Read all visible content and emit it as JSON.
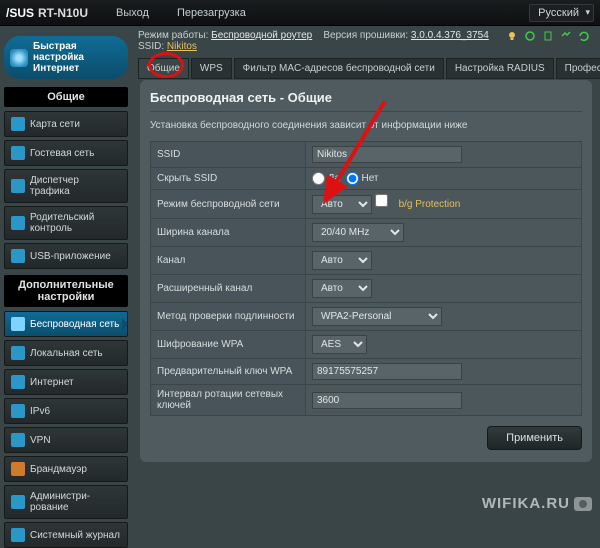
{
  "topbar": {
    "brand": "/SUS",
    "model": "RT-N10U",
    "logout": "Выход",
    "reboot": "Перезагрузка",
    "language": "Русский"
  },
  "header": {
    "mode_label": "Режим работы:",
    "mode_value": "Беспроводной роутер",
    "fw_label": "Версия прошивки:",
    "fw_value": "3.0.0.4.376_3754",
    "ssid_label": "SSID:",
    "ssid_value": "Nikitos"
  },
  "tabs": [
    "Общие",
    "WPS",
    "Фильтр MAC-адресов беспроводной сети",
    "Настройка RADIUS",
    "Профессионально"
  ],
  "quick": "Быстрая настройка Интернет",
  "section_general": "Общие",
  "nav_general": [
    "Карта сети",
    "Гостевая сеть",
    "Диспетчер трафика",
    "Родительский контроль",
    "USB-приложение"
  ],
  "section_adv": "Дополнительные настройки",
  "nav_adv": [
    "Беспроводная сеть",
    "Локальная сеть",
    "Интернет",
    "IPv6",
    "VPN",
    "Брандмауэр",
    "Администри-рование",
    "Системный журнал"
  ],
  "panel": {
    "title": "Беспроводная сеть - Общие",
    "desc": "Установка беспроводного соединения зависит от информации ниже",
    "rows": {
      "ssid": "SSID",
      "ssid_val": "Nikitos",
      "hide": "Скрыть SSID",
      "yes": "Да",
      "no": "Нет",
      "mode": "Режим беспроводной сети",
      "mode_val": "Авто",
      "bgp": "b/g Protection",
      "chwidth": "Ширина канала",
      "chwidth_val": "20/40 MHz",
      "channel": "Канал",
      "channel_val": "Авто",
      "extch": "Расширенный канал",
      "extch_val": "Авто",
      "auth": "Метод проверки подлинности",
      "auth_val": "WPA2-Personal",
      "enc": "Шифрование WPA",
      "enc_val": "AES",
      "psk": "Предварительный ключ WPA",
      "psk_val": "89175575257",
      "rekey": "Интервал ротации сетевых ключей",
      "rekey_val": "3600"
    },
    "apply": "Применить"
  },
  "watermark": "WIFIKA.RU"
}
